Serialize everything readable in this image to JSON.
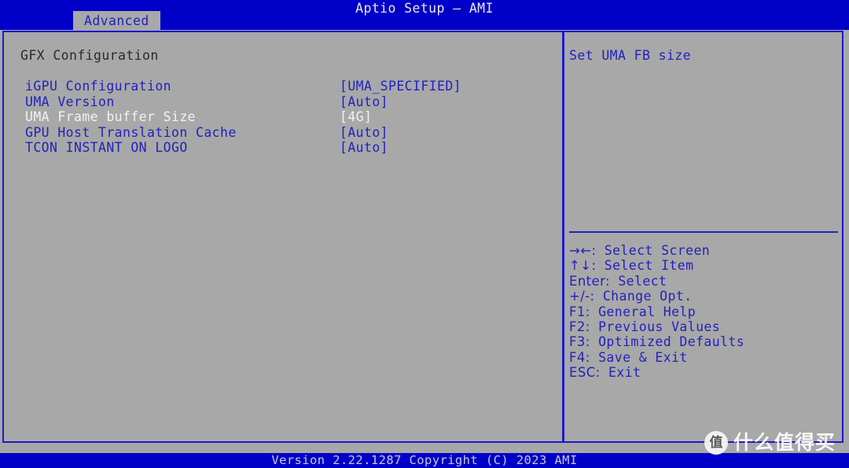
{
  "window": {
    "title": "Aptio Setup – AMI"
  },
  "tabs": [
    {
      "label": "Advanced",
      "active": true
    }
  ],
  "main": {
    "section_title": "GFX Configuration",
    "items": [
      {
        "label": "iGPU Configuration",
        "value": "[UMA_SPECIFIED]",
        "selected": false
      },
      {
        "label": "UMA Version",
        "value": "[Auto]",
        "selected": false
      },
      {
        "label": "UMA Frame buffer Size",
        "value": "[4G]",
        "selected": true
      },
      {
        "label": "GPU Host Translation Cache",
        "value": "[Auto]",
        "selected": false
      },
      {
        "label": "TCON INSTANT ON LOGO",
        "value": "[Auto]",
        "selected": false
      }
    ]
  },
  "help": {
    "text": "Set UMA FB size"
  },
  "legend": [
    {
      "keys": "→←:",
      "action": "Select Screen"
    },
    {
      "keys": "↑↓:",
      "action": "Select Item"
    },
    {
      "keys": "Enter:",
      "action": "Select"
    },
    {
      "keys": "+/-:",
      "action": "Change Opt."
    },
    {
      "keys": "F1:",
      "action": "General Help"
    },
    {
      "keys": "F2:",
      "action": "Previous Values"
    },
    {
      "keys": "F3:",
      "action": "Optimized Defaults"
    },
    {
      "keys": "F4:",
      "action": "Save & Exit"
    },
    {
      "keys": "ESC:",
      "action": "Exit"
    }
  ],
  "footer": {
    "version_text": "Version 2.22.1287 Copyright (C) 2023 AMI"
  },
  "watermark": {
    "logo_char": "值",
    "text": "什么值得买"
  },
  "colors": {
    "background_blue": "#0000c8",
    "panel_gray": "#a8a8a8",
    "text_blue": "#2222bb",
    "selected_white": "#f2f2f2",
    "title_white": "#e8e8e8"
  }
}
